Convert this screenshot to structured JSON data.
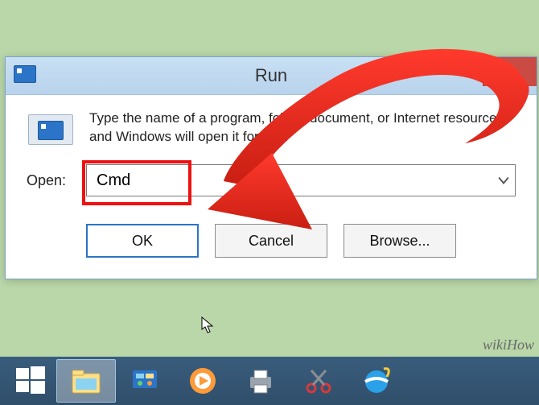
{
  "dialog": {
    "title": "Run",
    "close_label": "✕",
    "description": "Type the name of a program, folder, document, or Internet resource, and Windows will open it for you.",
    "open_label": "Open:",
    "open_value": "Cmd",
    "buttons": {
      "ok": "OK",
      "cancel": "Cancel",
      "browse": "Browse..."
    }
  },
  "taskbar": {
    "items": [
      {
        "name": "start",
        "label": "Start"
      },
      {
        "name": "file-explorer",
        "label": "File Explorer"
      },
      {
        "name": "control-panel",
        "label": "Control Panel"
      },
      {
        "name": "media-player",
        "label": "Media Player"
      },
      {
        "name": "printer",
        "label": "Printer"
      },
      {
        "name": "snipping-tool",
        "label": "Snipping Tool"
      },
      {
        "name": "internet-explorer",
        "label": "Internet Explorer"
      }
    ]
  },
  "watermark": "wikiHow",
  "colors": {
    "accent": "#2b74c7",
    "close": "#c94b44",
    "highlight": "#e11"
  }
}
